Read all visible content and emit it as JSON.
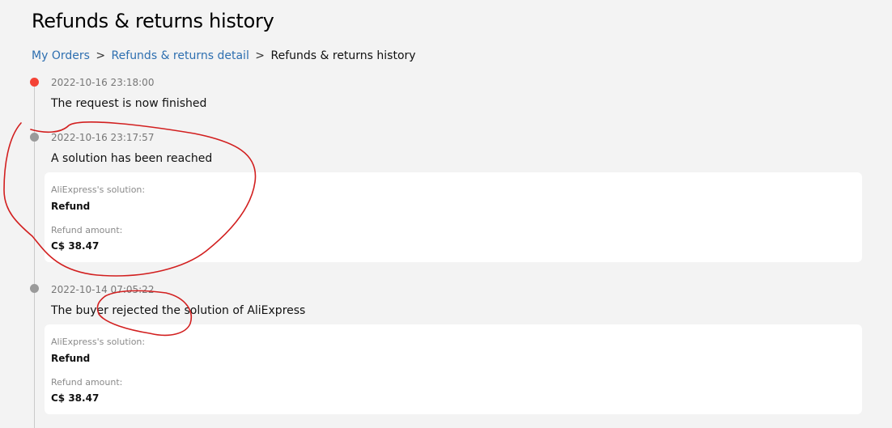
{
  "page": {
    "title": "Refunds & returns history"
  },
  "breadcrumb": {
    "items": [
      {
        "label": "My Orders"
      },
      {
        "label": "Refunds & returns detail"
      },
      {
        "label": "Refunds & returns history"
      }
    ],
    "separator": ">"
  },
  "timeline": {
    "events": [
      {
        "time": "2022-10-16 23:18:00",
        "title": "The request is now finished",
        "status": "active"
      },
      {
        "time": "2022-10-16 23:17:57",
        "title": "A solution has been reached",
        "details": [
          {
            "label": "AliExpress's solution:",
            "value": "Refund"
          },
          {
            "label": "Refund amount:",
            "value": "C$ 38.47"
          }
        ]
      },
      {
        "time": "2022-10-14 07:05:22",
        "title": "The buyer rejected the solution of AliExpress",
        "details": [
          {
            "label": "AliExpress's solution:",
            "value": "Refund"
          },
          {
            "label": "Refund amount:",
            "value": "C$ 38.47"
          }
        ]
      }
    ]
  },
  "colors": {
    "background": "#f3f3f3",
    "link": "#2e6fb0",
    "active_dot": "#f44336",
    "inactive_dot": "#9a9a9a",
    "annotation_ink": "#d21f1f"
  }
}
